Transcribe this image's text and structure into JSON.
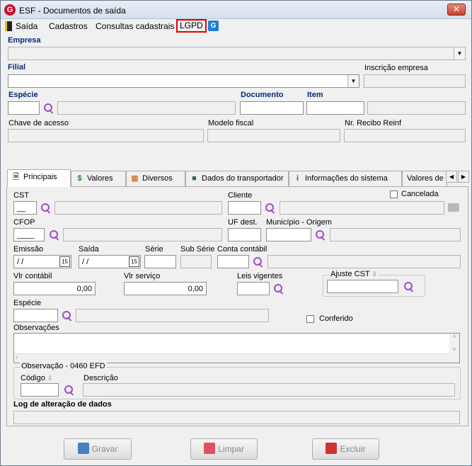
{
  "window": {
    "title": "ESF - Documentos de saída",
    "logo_letter": "G",
    "close_symbol": "✕"
  },
  "menu": {
    "items": [
      "Saída",
      "Cadastros",
      "Consultas cadastrais",
      "LGPD"
    ],
    "help_icon": "help-icon"
  },
  "header": {
    "empresa_label": "Empresa",
    "filial_label": "Filial",
    "inscricao_label": "Inscrição empresa",
    "especie_label": "Espécie",
    "documento_label": "Documento",
    "item_label": "Item",
    "chave_label": "Chave de acesso",
    "modelo_label": "Modelo fiscal",
    "recibo_label": "Nr. Recibo Reinf"
  },
  "tabs": [
    {
      "label": "Principais",
      "icon": "page-icon",
      "active": true
    },
    {
      "label": "Valores",
      "icon": "money-icon"
    },
    {
      "label": "Diversos",
      "icon": "calendar-icon"
    },
    {
      "label": "Dados do transportador",
      "icon": "truck-icon"
    },
    {
      "label": "Informações do sistema",
      "icon": "info-icon"
    },
    {
      "label": "Valores de in",
      "icon": "none"
    }
  ],
  "principais": {
    "cst_label": "CST",
    "cst_value": "__",
    "cliente_label": "Cliente",
    "cancelada_label": "Cancelada",
    "cfop_label": "CFOP",
    "cfop_value": "____",
    "uf_dest_label": "UF dest.",
    "municipio_label": "Município - Origem",
    "emissao_label": "Emissão",
    "emissao_value": " / /",
    "saida_label": "Saída",
    "saida_value": " / /",
    "serie_label": "Série",
    "sub_serie_label": "Sub Série",
    "conta_contabil_label": "Conta contábil",
    "vlr_contabil_label": "Vlr contábil",
    "vlr_contabil_value": "0,00",
    "vlr_servico_label": "Vlr serviço",
    "vlr_servico_value": "0,00",
    "leis_vigentes_label": "Leis vigentes",
    "ajuste_cst_label": "Ajuste CST",
    "especie_label": "Espécie",
    "conferido_label": "Conferido",
    "observacoes_label": "Observações",
    "obs_group_title": "Observação - 0460 EFD",
    "codigo_label": "Código",
    "descricao_label": "Descrição",
    "log_label": "Log de alteração de dados",
    "calendar_glyph": "15"
  },
  "buttons": {
    "gravar": "Gravar",
    "limpar": "Limpar",
    "excluir": "Excluir"
  },
  "colors": {
    "accent_label": "#0a2a7a",
    "lgpd_highlight": "#e00000",
    "search_icon": "#a14bc9"
  }
}
